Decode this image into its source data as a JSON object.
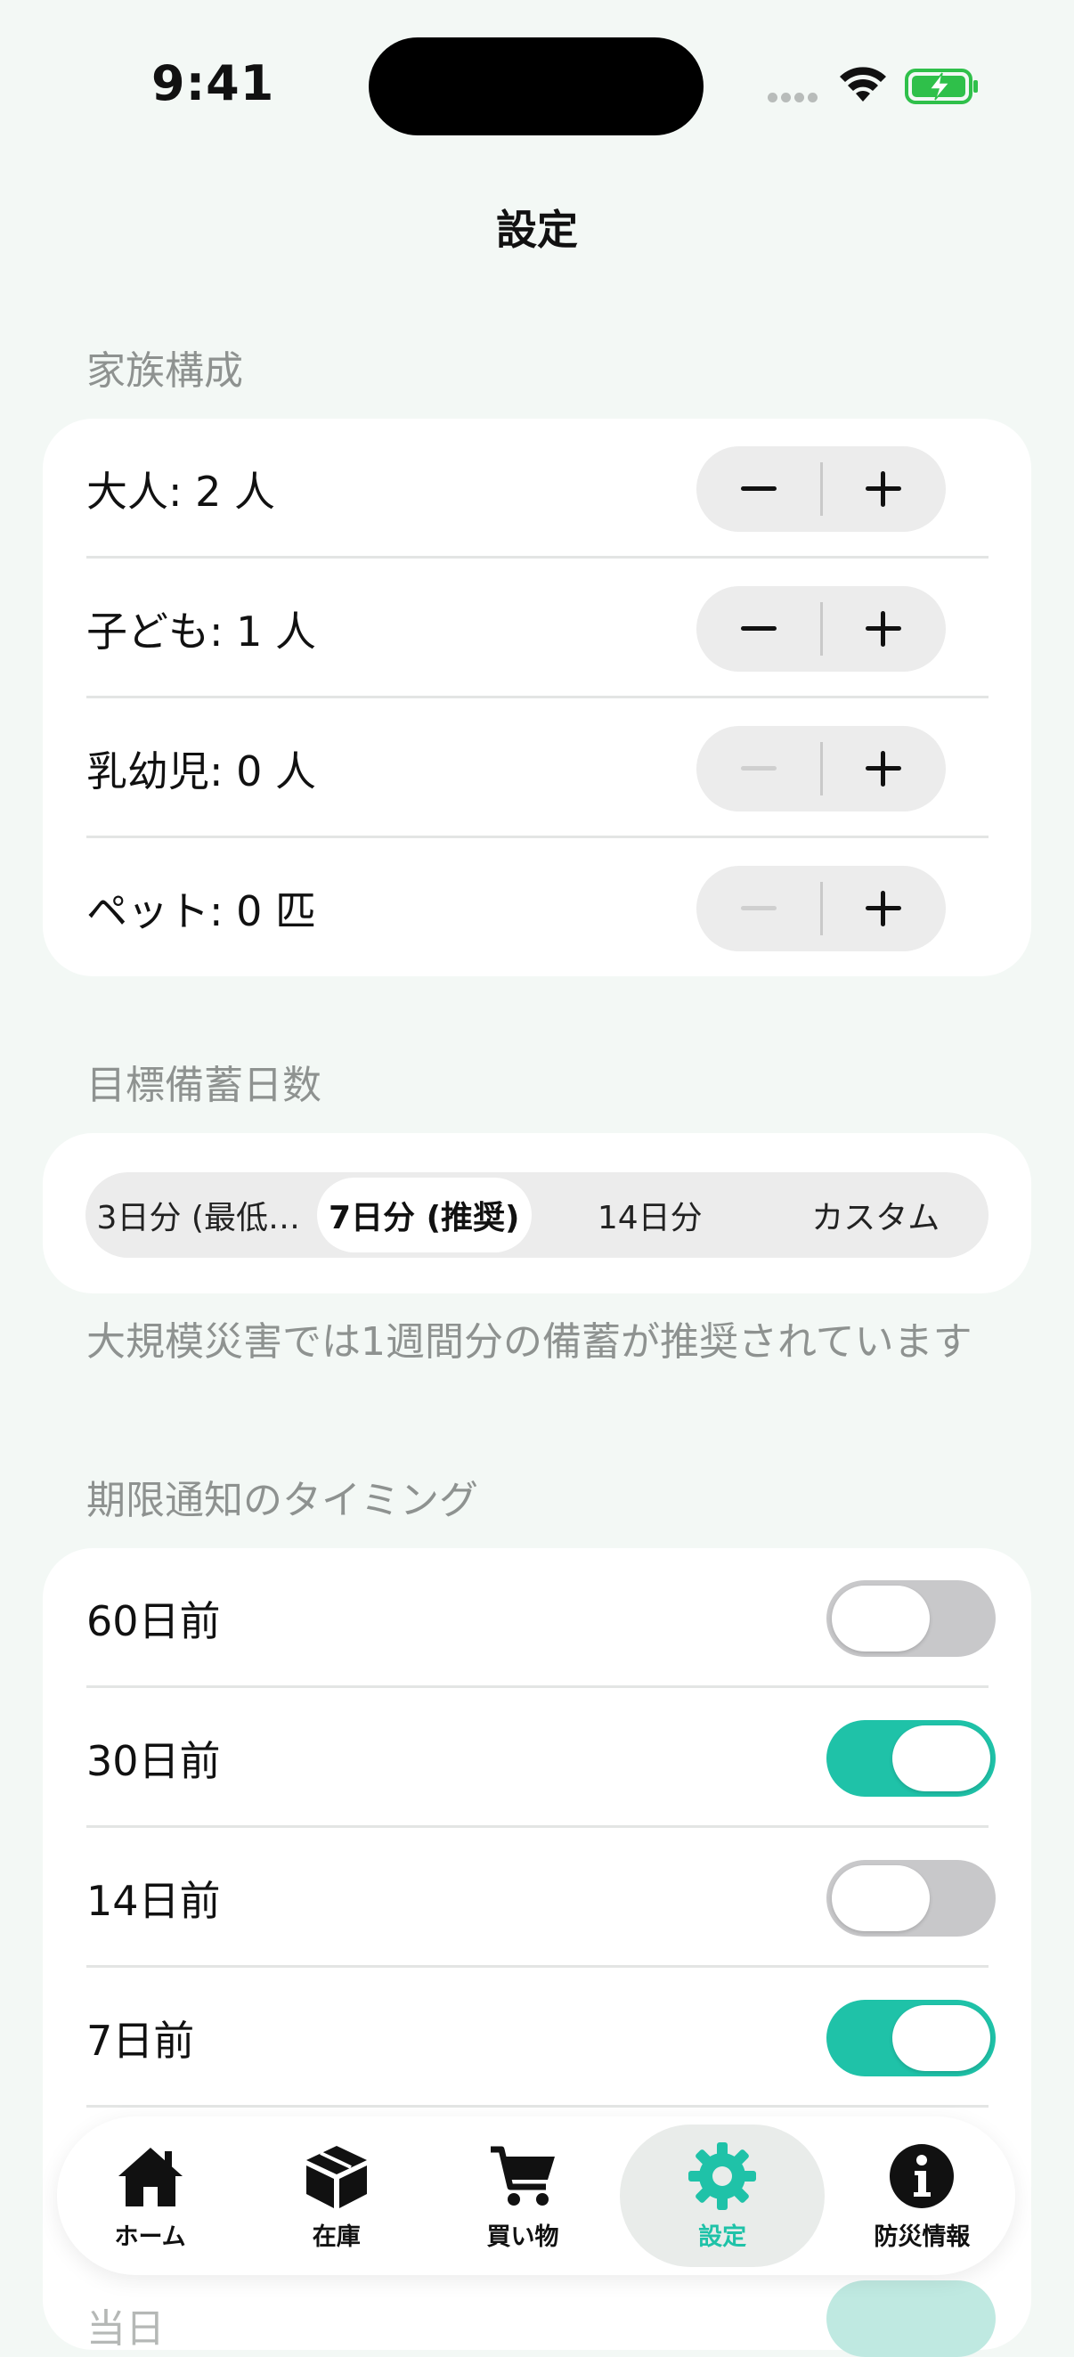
{
  "status_bar": {
    "time": "9:41"
  },
  "page": {
    "title": "設定"
  },
  "family": {
    "header": "家族構成",
    "rows": [
      {
        "label": "大人: 2 人",
        "minus_enabled": true
      },
      {
        "label": "子ども: 1 人",
        "minus_enabled": true
      },
      {
        "label": "乳幼児: 0 人",
        "minus_enabled": false
      },
      {
        "label": "ペット: 0 匹",
        "minus_enabled": false
      }
    ]
  },
  "target_days": {
    "header": "目標備蓄日数",
    "options": [
      "3日分 (最低…",
      "7日分 (推奨)",
      "14日分",
      "カスタム"
    ],
    "selected_index": 1,
    "footnote": "大規模災害では1週間分の備蓄が推奨されています"
  },
  "notifications": {
    "header": "期限通知のタイミング",
    "rows": [
      {
        "label": "60日前",
        "on": false
      },
      {
        "label": "30日前",
        "on": true
      },
      {
        "label": "14日前",
        "on": false
      },
      {
        "label": "7日前",
        "on": true
      }
    ],
    "partial_label": "当日"
  },
  "tabbar": {
    "tabs": [
      {
        "label": "ホーム",
        "icon": "house-icon"
      },
      {
        "label": "在庫",
        "icon": "box-icon"
      },
      {
        "label": "買い物",
        "icon": "cart-icon"
      },
      {
        "label": "設定",
        "icon": "gear-icon"
      },
      {
        "label": "防災情報",
        "icon": "info-icon"
      }
    ],
    "active_index": 3
  },
  "colors": {
    "accent": "#1fc2a8",
    "background": "#f3f8f5",
    "card": "#ffffff",
    "secondary_text": "#8e9290"
  }
}
